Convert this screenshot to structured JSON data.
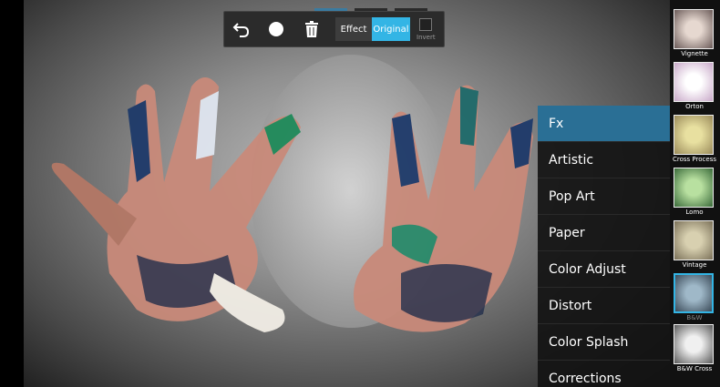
{
  "toolbar": {
    "undo_icon": "undo-icon",
    "brush_icon": "circle-brush-icon",
    "trash_icon": "trash-icon",
    "effect_label": "Effect",
    "original_label": "Original",
    "invert_label": "Invert"
  },
  "menu": {
    "items": [
      {
        "label": "Fx"
      },
      {
        "label": "Artistic"
      },
      {
        "label": "Pop Art"
      },
      {
        "label": "Paper"
      },
      {
        "label": "Color Adjust"
      },
      {
        "label": "Distort"
      },
      {
        "label": "Color Splash"
      },
      {
        "label": "Corrections"
      }
    ],
    "selected": "Fx"
  },
  "thumbnails": {
    "items": [
      {
        "label": "Vignette"
      },
      {
        "label": "Orton"
      },
      {
        "label": "Cross Process"
      },
      {
        "label": "Lomo"
      },
      {
        "label": "Vintage"
      },
      {
        "label": "B&W"
      },
      {
        "label": "B&W Cross"
      }
    ],
    "selected": "B&W"
  },
  "colors": {
    "accent": "#33b5e5",
    "menu_selected": "#2a6f95"
  }
}
